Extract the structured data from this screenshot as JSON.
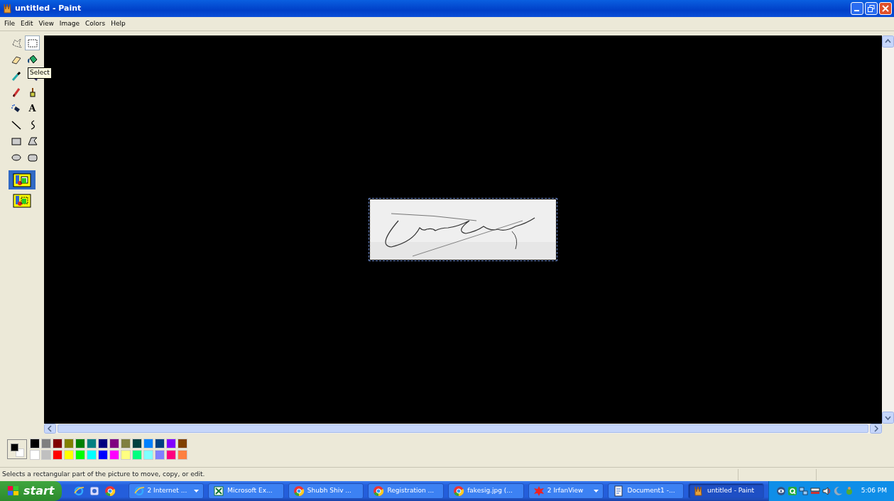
{
  "window": {
    "title": "untitled - Paint"
  },
  "menu": [
    "File",
    "Edit",
    "View",
    "Image",
    "Colors",
    "Help"
  ],
  "tools": [
    {
      "kind": "free-select",
      "selected": false
    },
    {
      "kind": "rect-select",
      "selected": true
    },
    {
      "kind": "eraser",
      "selected": false
    },
    {
      "kind": "fill",
      "selected": false
    },
    {
      "kind": "picker",
      "selected": false
    },
    {
      "kind": "magnifier",
      "selected": false
    },
    {
      "kind": "pencil",
      "selected": false
    },
    {
      "kind": "brush",
      "selected": false
    },
    {
      "kind": "airbrush",
      "selected": false
    },
    {
      "kind": "text",
      "glyph": "A",
      "selected": false
    },
    {
      "kind": "line",
      "selected": false
    },
    {
      "kind": "curve",
      "selected": false
    },
    {
      "kind": "rectangle",
      "selected": false
    },
    {
      "kind": "polygon",
      "selected": false
    },
    {
      "kind": "ellipse",
      "selected": false
    },
    {
      "kind": "rounded-rectangle",
      "selected": false
    }
  ],
  "tool_options": [
    {
      "kind": "opaque",
      "selected": true
    },
    {
      "kind": "transparent",
      "selected": false
    }
  ],
  "tooltip": "Select",
  "canvas": {
    "selection": true
  },
  "current_colors": [
    {
      "kind": "foreground",
      "color": "#000000"
    },
    {
      "kind": "background",
      "color": "#ffffff"
    }
  ],
  "palette": [
    {
      "color": "#000000"
    },
    {
      "color": "#808080"
    },
    {
      "color": "#800000"
    },
    {
      "color": "#808000"
    },
    {
      "color": "#008000"
    },
    {
      "color": "#008080"
    },
    {
      "color": "#000080"
    },
    {
      "color": "#800080"
    },
    {
      "color": "#808040"
    },
    {
      "color": "#004040"
    },
    {
      "color": "#0080ff"
    },
    {
      "color": "#004080"
    },
    {
      "color": "#8000ff"
    },
    {
      "color": "#804000"
    },
    {
      "color": "#ffffff"
    },
    {
      "color": "#c0c0c0"
    },
    {
      "color": "#ff0000"
    },
    {
      "color": "#ffff00"
    },
    {
      "color": "#00ff00"
    },
    {
      "color": "#00ffff"
    },
    {
      "color": "#0000ff"
    },
    {
      "color": "#ff00ff"
    },
    {
      "color": "#ffff80"
    },
    {
      "color": "#00ff80"
    },
    {
      "color": "#80ffff"
    },
    {
      "color": "#8080ff"
    },
    {
      "color": "#ff0080"
    },
    {
      "color": "#ff8040"
    }
  ],
  "status_bar": "Selects a rectangular part of the picture to move, copy, or edit.",
  "taskbar": {
    "start": "start",
    "quick_launch": [
      {
        "kind": "ie"
      },
      {
        "kind": "mail"
      },
      {
        "kind": "chrome"
      }
    ],
    "tasks": [
      {
        "label": "2 Internet ...",
        "kind": "ie",
        "grouped": true,
        "selected": false
      },
      {
        "label": "Microsoft Ex...",
        "kind": "excel",
        "grouped": false,
        "selected": false
      },
      {
        "label": "Shubh Shiv ...",
        "kind": "chrome",
        "grouped": false,
        "selected": false
      },
      {
        "label": "Registration ...",
        "kind": "chrome",
        "grouped": false,
        "selected": false
      },
      {
        "label": "fakesig.jpg (...",
        "kind": "chrome",
        "grouped": false,
        "selected": false
      },
      {
        "label": "2 IrfanView",
        "kind": "irfan",
        "grouped": true,
        "selected": false
      },
      {
        "label": "Document1 -...",
        "kind": "word",
        "grouped": false,
        "selected": false
      },
      {
        "label": "untitled - Paint",
        "kind": "paint",
        "grouped": false,
        "selected": true
      }
    ],
    "tray": [
      {
        "kind": "eye"
      },
      {
        "kind": "q"
      },
      {
        "kind": "network"
      },
      {
        "kind": "drive"
      },
      {
        "kind": "speaker"
      },
      {
        "kind": "moon"
      },
      {
        "kind": "bug"
      }
    ],
    "clock": "5:06 PM"
  }
}
